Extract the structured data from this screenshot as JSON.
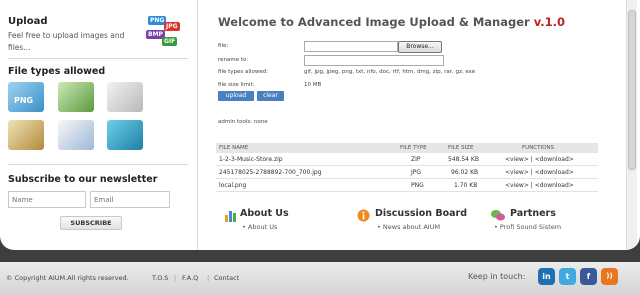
{
  "sidebar": {
    "upload_title": "Upload",
    "upload_desc": "Feel free to upload images and files...",
    "format_badges": [
      "PNG",
      "JPG",
      "BMP",
      "GIF"
    ],
    "file_types_heading": "File types allowed",
    "file_type_icons": [
      "png-image-icon",
      "jpg-photo-icon",
      "gif-image-icon",
      "zip-archive-icon",
      "document-icon",
      "disc-icon"
    ],
    "newsletter_heading": "Subscribe to our newsletter",
    "name_placeholder": "Name",
    "email_placeholder": "Email",
    "subscribe_label": "SUBSCRIBE"
  },
  "main": {
    "title": "Welcome to Advanced Image Upload & Manager",
    "version": "v.1.0",
    "form": {
      "file_label": "file:",
      "browse_label": "Browse...",
      "rename_label": "rename to:",
      "types_label": "file types allowed:",
      "types_value": "gif, jpg, jpeg, png, txt, nfo, doc, rtf, htm, dmg, zip, rar, gz, exe",
      "size_label": "file size limit:",
      "size_value": "10 MB",
      "upload_button": "upload",
      "clear_button": "clear"
    },
    "admin_tools": "admin tools: none",
    "table": {
      "headers": [
        "FILE NAME",
        "FILE TYPE",
        "FILE SIZE",
        "FUNCTIONS"
      ],
      "rows": [
        {
          "name": "1-2-3-Music-Store.zip",
          "type": "ZIP",
          "size": "548.54 KB",
          "functions": "<view> | <download>"
        },
        {
          "name": "245178025-2788892-700_700.jpg",
          "type": "JPG",
          "size": "96.02 KB",
          "functions": "<view> | <download>"
        },
        {
          "name": "local.png",
          "type": "PNG",
          "size": "1.70 KB",
          "functions": "<view> | <download>"
        }
      ]
    },
    "bottom_sections": [
      {
        "title": "About Us",
        "link": "About Us"
      },
      {
        "title": "Discussion Board",
        "link": "News about AIUM"
      },
      {
        "title": "Partners",
        "link": "Profi Sound Sistem"
      }
    ]
  },
  "footer": {
    "copyright": "© Copyright AIUM.All rights reserved.",
    "links": [
      "T.O.S",
      "F.A.Q",
      "Contact"
    ],
    "keep_in_touch": "Keep in touch:",
    "social": [
      {
        "name": "linkedin",
        "glyph": "in",
        "color": "#1f6fb2"
      },
      {
        "name": "twitter",
        "glyph": "t",
        "color": "#3fa9e0"
      },
      {
        "name": "facebook",
        "glyph": "f",
        "color": "#3b5998"
      },
      {
        "name": "rss",
        "glyph": "))",
        "color": "#e8761f"
      }
    ]
  },
  "colors": {
    "version_red": "#b8251e",
    "button_blue": "#4a7fc1",
    "footer_dark": "#3e3e3e"
  }
}
